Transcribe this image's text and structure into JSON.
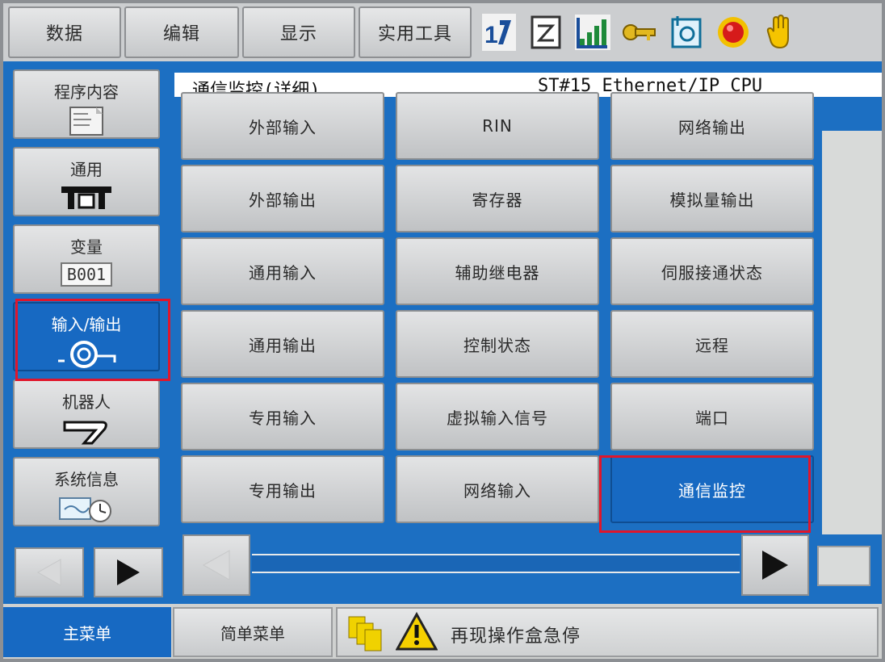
{
  "top_menu": {
    "tabs": [
      {
        "label": "数据"
      },
      {
        "label": "编辑"
      },
      {
        "label": "显示"
      },
      {
        "label": "实用工具"
      }
    ],
    "status_icons": [
      "tool-number-icon",
      "edit-mode-icon",
      "speed-signal-icon",
      "key-mode-icon",
      "tool-coord-icon",
      "servo-lamp-icon",
      "hand-icon"
    ]
  },
  "sidebar": {
    "items": [
      {
        "label": "程序内容",
        "icon": "program-document-icon",
        "active": false
      },
      {
        "label": "通用",
        "icon": "general-tool-icon",
        "active": false
      },
      {
        "label": "变量",
        "icon": "variable-box-icon",
        "badge": "B001",
        "active": false
      },
      {
        "label": "输入/输出",
        "icon": "io-connector-icon",
        "active": true
      },
      {
        "label": "机器人",
        "icon": "robot-arm-icon",
        "active": false
      },
      {
        "label": "系统信息",
        "icon": "system-info-icon",
        "active": false
      }
    ]
  },
  "title": {
    "left": "通信监控(详细)",
    "right": "ST#15  Ethernet/IP CPU"
  },
  "grid": {
    "col1": [
      "外部输入",
      "外部输出",
      "通用输入",
      "通用输出",
      "专用输入",
      "专用输出"
    ],
    "col2": [
      "RIN",
      "寄存器",
      "辅助继电器",
      "控制状态",
      "虚拟输入信号",
      "网络输入"
    ],
    "col3": [
      "网络输出",
      "模拟量输出",
      "伺服接通状态",
      "远程",
      "端口",
      "通信监控"
    ]
  },
  "bottom": {
    "main_menu": "主菜单",
    "simple_menu": "简单菜单",
    "message": "再现操作盒急停"
  },
  "colors": {
    "accent": "#1769c2",
    "highlight": "#e0162b"
  }
}
